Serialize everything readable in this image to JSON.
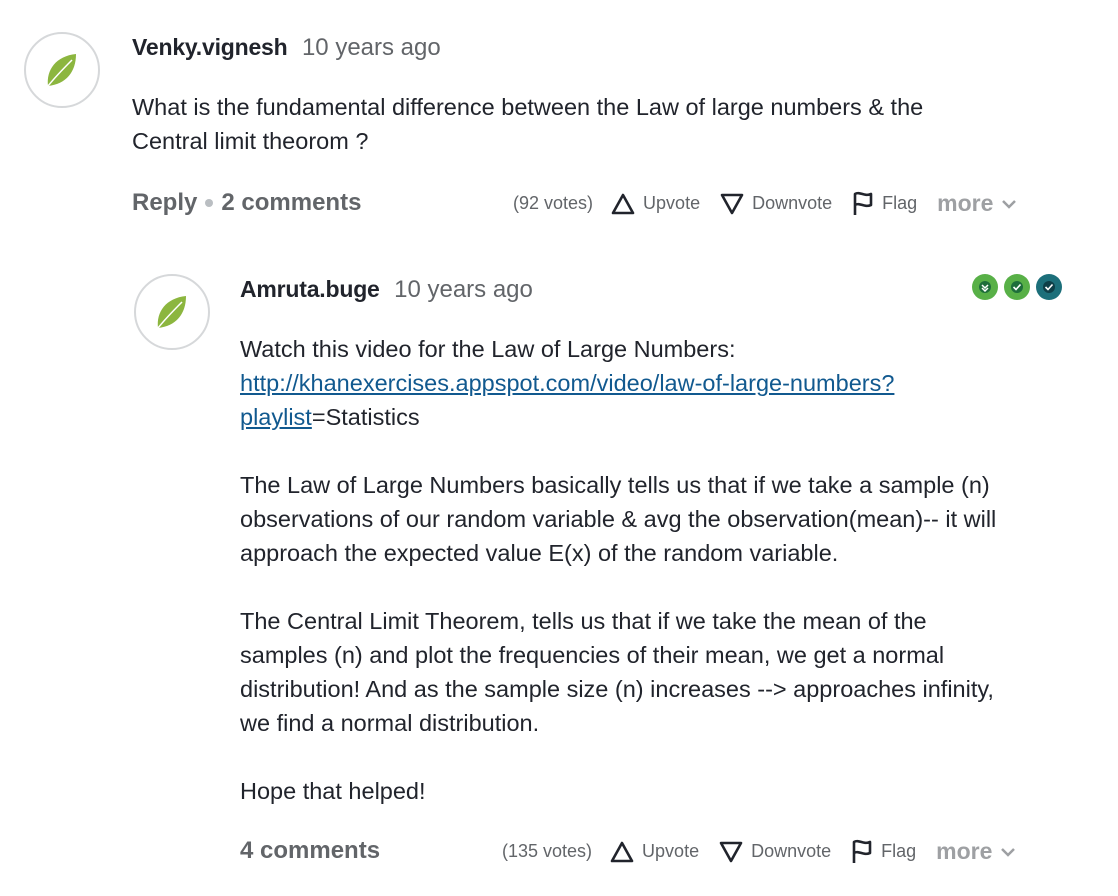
{
  "question": {
    "author": "Venky.vignesh",
    "time": "10 years ago",
    "text_line1": "What is the fundamental difference between the Law of large numbers & the",
    "text_line2": "Central limit theorom ?",
    "reply_label": "Reply",
    "comments_label": "2 comments",
    "votes": "(92 votes)",
    "upvote_label": "Upvote",
    "downvote_label": "Downvote",
    "flag_label": "Flag",
    "more_label": "more"
  },
  "answer": {
    "author": "Amruta.buge",
    "time": "10 years ago",
    "line1": "Watch this video for the Law of Large Numbers:",
    "link_part1": "http://khanexercises.appspot.com/video/law-of-large-numbers?",
    "link_part2": "playlist",
    "link_suffix": "=Statistics",
    "para2_line1": "The Law of Large Numbers basically tells us that if we take a sample (n)",
    "para2_line2": "observations of our random variable & avg the observation(mean)-- it will",
    "para2_line3": "approach the expected value E(x) of the random variable.",
    "para3_line1": "The Central Limit Theorem, tells us that if we take the mean of the",
    "para3_line2": "samples (n) and plot the frequencies of their mean, we get a normal",
    "para3_line3": "distribution! And as the sample size (n) increases --> approaches infinity,",
    "para3_line4": "we find a normal distribution.",
    "para4": "Hope that helped!",
    "comments_label": "4 comments",
    "votes": "(135 votes)",
    "upvote_label": "Upvote",
    "downvote_label": "Downvote",
    "flag_label": "Flag",
    "more_label": "more"
  },
  "colors": {
    "leaf": "#8cb63f",
    "badge_green": "#58b047",
    "badge_teal": "#1c6f7a",
    "link": "#11598f"
  }
}
